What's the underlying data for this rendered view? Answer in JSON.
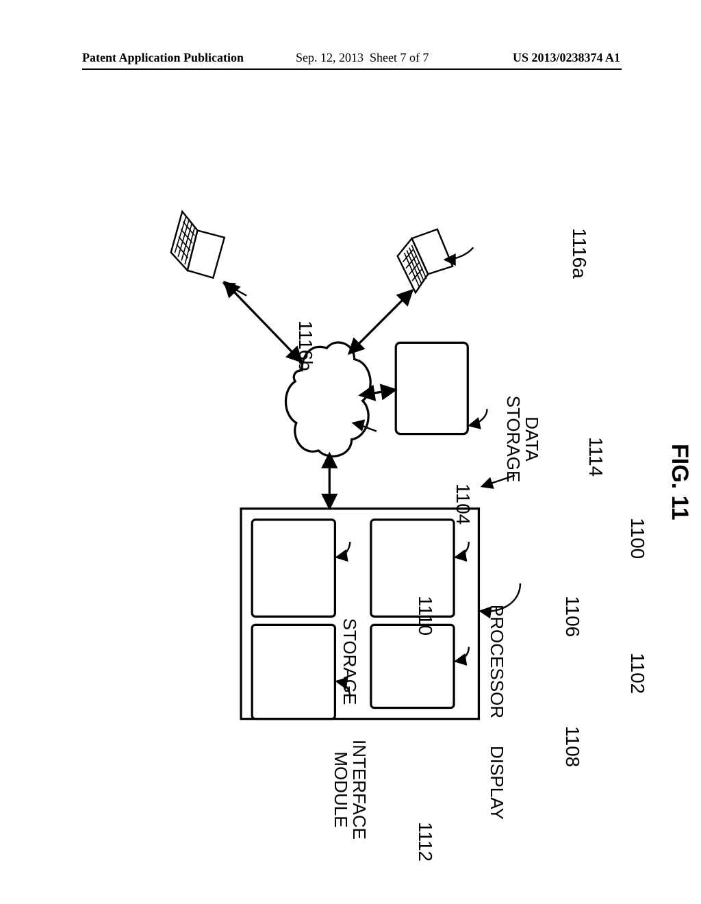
{
  "header": {
    "left": "Patent Application Publication",
    "date": "Sep. 12, 2013",
    "sheet": "Sheet 7 of 7",
    "pubno": "US 2013/0238374 A1"
  },
  "figure": {
    "title": "FIG. 11",
    "refs": {
      "system": "1100",
      "computer": "1102",
      "network": "1104",
      "processor": "1106",
      "display": "1108",
      "storage": "1110",
      "interface": "1112",
      "datastorage": "1114",
      "client_a": "1116a",
      "client_b": "1116b"
    },
    "blocks": {
      "processor": "PROCESSOR",
      "display": "DISPLAY",
      "storage": "STORAGE",
      "interface_l1": "INTERFACE",
      "interface_l2": "MODULE",
      "datastorage_l1": "DATA",
      "datastorage_l2": "STORAGE"
    }
  }
}
